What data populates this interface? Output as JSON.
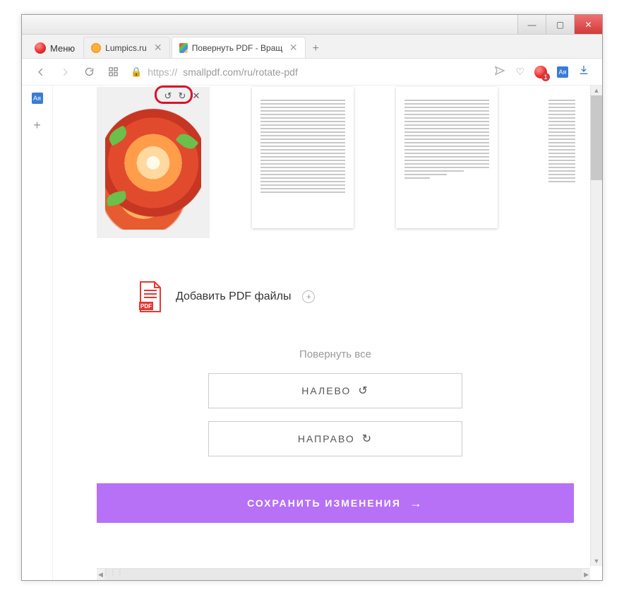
{
  "window": {
    "minimize": "—",
    "maximize": "▢",
    "close": "✕"
  },
  "menu": {
    "label": "Меню"
  },
  "tabs": [
    {
      "title": "Lumpics.ru"
    },
    {
      "title": "Повернуть PDF - Вращать"
    }
  ],
  "tab_new": "+",
  "address": {
    "scheme": "https://",
    "rest": "smallpdf.com/ru/rotate-pdf",
    "opera_count": "1",
    "translate_badge": "Ая"
  },
  "thumb_toolbar": {
    "rotate_left": "↺",
    "rotate_right": "↻",
    "remove": "✕"
  },
  "add_files": {
    "label": "Добавить PDF файлы",
    "pdf_badge": "PDF",
    "plus": "+"
  },
  "rotate_all": {
    "title": "Повернуть все",
    "left": "НАЛЕВО",
    "left_icon": "↺",
    "right": "НАПРАВО",
    "right_icon": "↻"
  },
  "save": {
    "label": "СОХРАНИТЬ ИЗМЕНЕНИЯ",
    "arrow": "→"
  }
}
